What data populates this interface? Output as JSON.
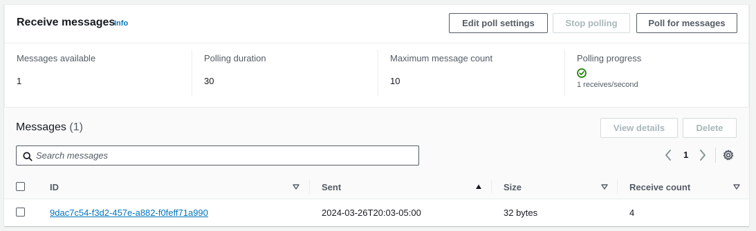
{
  "receive": {
    "title": "Receive messages",
    "info": "Info",
    "buttons": {
      "edit": "Edit poll settings",
      "stop": "Stop polling",
      "poll": "Poll for messages"
    },
    "stats": {
      "available_label": "Messages available",
      "available_value": "1",
      "duration_label": "Polling duration",
      "duration_value": "30",
      "max_label": "Maximum message count",
      "max_value": "10",
      "progress_label": "Polling progress",
      "progress_rate": "1 receives/second",
      "progress_icon": "check-circle-icon"
    }
  },
  "messages": {
    "title": "Messages",
    "count": "(1)",
    "buttons": {
      "details": "View details",
      "delete": "Delete"
    },
    "search_placeholder": "Search messages",
    "pagination": {
      "current": "1"
    },
    "columns": [
      "ID",
      "Sent",
      "Size",
      "Receive count"
    ],
    "rows": [
      {
        "id": "9dac7c54-f3d2-457e-a882-f0feff71a990",
        "sent": "2024-03-26T20:03-05:00",
        "size": "32 bytes",
        "receive_count": "4"
      }
    ]
  },
  "colors": {
    "link": "#0073bb",
    "success": "#1d8102",
    "text": "#16191f",
    "secondary": "#545b64",
    "disabled": "#aab7b8"
  }
}
